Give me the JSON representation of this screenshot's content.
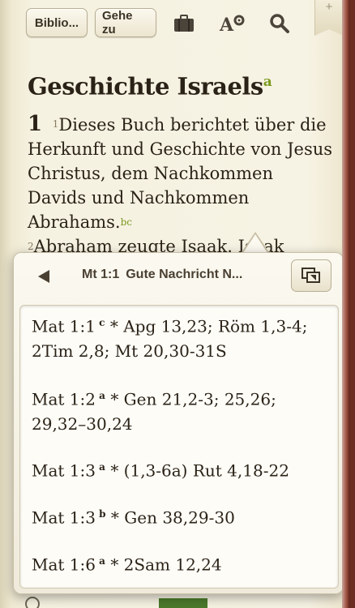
{
  "toolbar": {
    "library_label": "Biblio...",
    "goto_label": "Gehe zu",
    "icons": [
      "briefcase-icon",
      "font-settings-icon",
      "search-icon",
      "bookmark-ribbon-icon"
    ],
    "ribbon_plus": "+"
  },
  "passage": {
    "title": "Geschichte Israels",
    "title_note": "a",
    "chapter": "1",
    "verse1_num": "1",
    "verse1_text": "Dieses Buch berichtet über die Herkunft und Geschichte von Jesus Christus, dem Nachkommen Davids und Nachkommen Abrahams.",
    "verse1_notes": "bc",
    "verse2_num": "2",
    "verse2_text": "Abraham zeugte Isaak. Isaak"
  },
  "popup": {
    "reference": "Mt 1:1",
    "translation": "Gute Nachricht N...",
    "notes": [
      {
        "ref": "Mat 1:1",
        "mark": "c",
        "text": "* Apg 13,23; Röm 1,3-4; 2Tim 2,8; Mt 20,30-31S"
      },
      {
        "ref": "Mat 1:2",
        "mark": "a",
        "text": "* Gen 21,2-3; 25,26; 29,32–30,24"
      },
      {
        "ref": "Mat 1:3",
        "mark": "a",
        "text": "* (1,3-6a) Rut 4,18-22"
      },
      {
        "ref": "Mat 1:3",
        "mark": "b",
        "text": "* Gen 38,29-30"
      },
      {
        "ref": "Mat 1:6",
        "mark": "a",
        "text": "* 2Sam 12,24"
      }
    ]
  },
  "colors": {
    "accent_green": "#7a9a1e",
    "paper": "#f7f3e4",
    "text": "#2a2217"
  }
}
